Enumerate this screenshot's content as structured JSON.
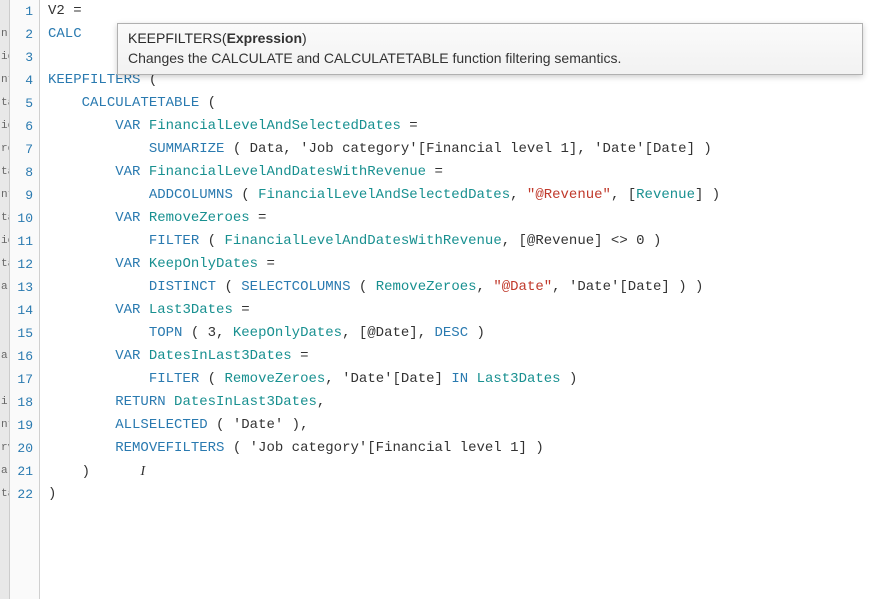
{
  "left_strip": [
    "",
    "n",
    "ic",
    "nt",
    "ta",
    "ic",
    "re",
    "ta",
    "nt",
    "ta",
    "ic",
    "ta",
    "al",
    "",
    "",
    "a",
    "",
    "il",
    "nt",
    "rv",
    "ar",
    "ta"
  ],
  "line_numbers": [
    "1",
    "2",
    "3",
    "4",
    "5",
    "6",
    "7",
    "8",
    "9",
    "10",
    "11",
    "12",
    "13",
    "14",
    "15",
    "16",
    "17",
    "18",
    "19",
    "20",
    "21",
    "22"
  ],
  "tooltip": {
    "fn": "KEEPFILTERS",
    "param": "Expression",
    "desc": "Changes the CALCULATE and CALCULATETABLE function filtering semantics."
  },
  "code": {
    "l1_a": "V2 =",
    "l2_a": "CALC",
    "l3_blank": "",
    "l4_kw": "KEEPFILTERS",
    "l4_tail": " (",
    "l5_kw": "CALCULATETABLE",
    "l5_tail": " (",
    "l6_kw": "VAR",
    "l6_var": " FinancialLevelAndSelectedDates",
    "l6_tail": " =",
    "l7_kw": "SUMMARIZE",
    "l7_mid": " ( Data, ",
    "l7_s1": "'Job category'",
    "l7_b1": "[Financial level 1]",
    "l7_sep": ", ",
    "l7_s2": "'Date'",
    "l7_b2": "[Date]",
    "l7_tail": " )",
    "l8_kw": "VAR",
    "l8_var": " FinancialLevelAndDatesWithRevenue",
    "l8_tail": " =",
    "l9_kw": "ADDCOLUMNS",
    "l9_mid": " ( ",
    "l9_v1": "FinancialLevelAndSelectedDates",
    "l9_sep": ", ",
    "l9_str": "\"@Revenue\"",
    "l9_sep2": ", [",
    "l9_v2": "Revenue",
    "l9_tail": "] )",
    "l10_kw": "VAR",
    "l10_var": " RemoveZeroes",
    "l10_tail": " =",
    "l11_kw": "FILTER",
    "l11_mid": " ( ",
    "l11_v1": "FinancialLevelAndDatesWithRevenue",
    "l11_sep": ", [@Revenue] <> 0 )",
    "l12_kw": "VAR",
    "l12_var": " KeepOnlyDates",
    "l12_tail": " =",
    "l13_kw": "DISTINCT",
    "l13_mid": " ( ",
    "l13_kw2": "SELECTCOLUMNS",
    "l13_mid2": " ( ",
    "l13_v1": "RemoveZeroes",
    "l13_sep": ", ",
    "l13_str": "\"@Date\"",
    "l13_sep2": ", ",
    "l13_s1": "'Date'",
    "l13_b1": "[Date]",
    "l13_tail": " ) )",
    "l14_kw": "VAR",
    "l14_var": " Last3Dates",
    "l14_tail": " =",
    "l15_kw": "TOPN",
    "l15_mid": " ( 3, ",
    "l15_v1": "KeepOnlyDates",
    "l15_sep": ", [@Date], ",
    "l15_kw2": "DESC",
    "l15_tail": " )",
    "l16_kw": "VAR",
    "l16_var": " DatesInLast3Dates",
    "l16_tail": " =",
    "l17_kw": "FILTER",
    "l17_mid": " ( ",
    "l17_v1": "RemoveZeroes",
    "l17_sep": ", ",
    "l17_s1": "'Date'",
    "l17_b1": "[Date]",
    "l17_kw2": " IN ",
    "l17_v2": "Last3Dates",
    "l17_tail": " )",
    "l18_kw": "RETURN",
    "l18_var": " DatesInLast3Dates",
    "l18_tail": ",",
    "l19_kw": "ALLSELECTED",
    "l19_mid": " ( ",
    "l19_s1": "'Date'",
    "l19_tail": " ),",
    "l20_kw": "REMOVEFILTERS",
    "l20_mid": " ( ",
    "l20_s1": "'Job category'",
    "l20_b1": "[Financial level 1]",
    "l20_tail": " )",
    "l21_a": ")",
    "l21_caret": "I",
    "l22_a": ")"
  }
}
